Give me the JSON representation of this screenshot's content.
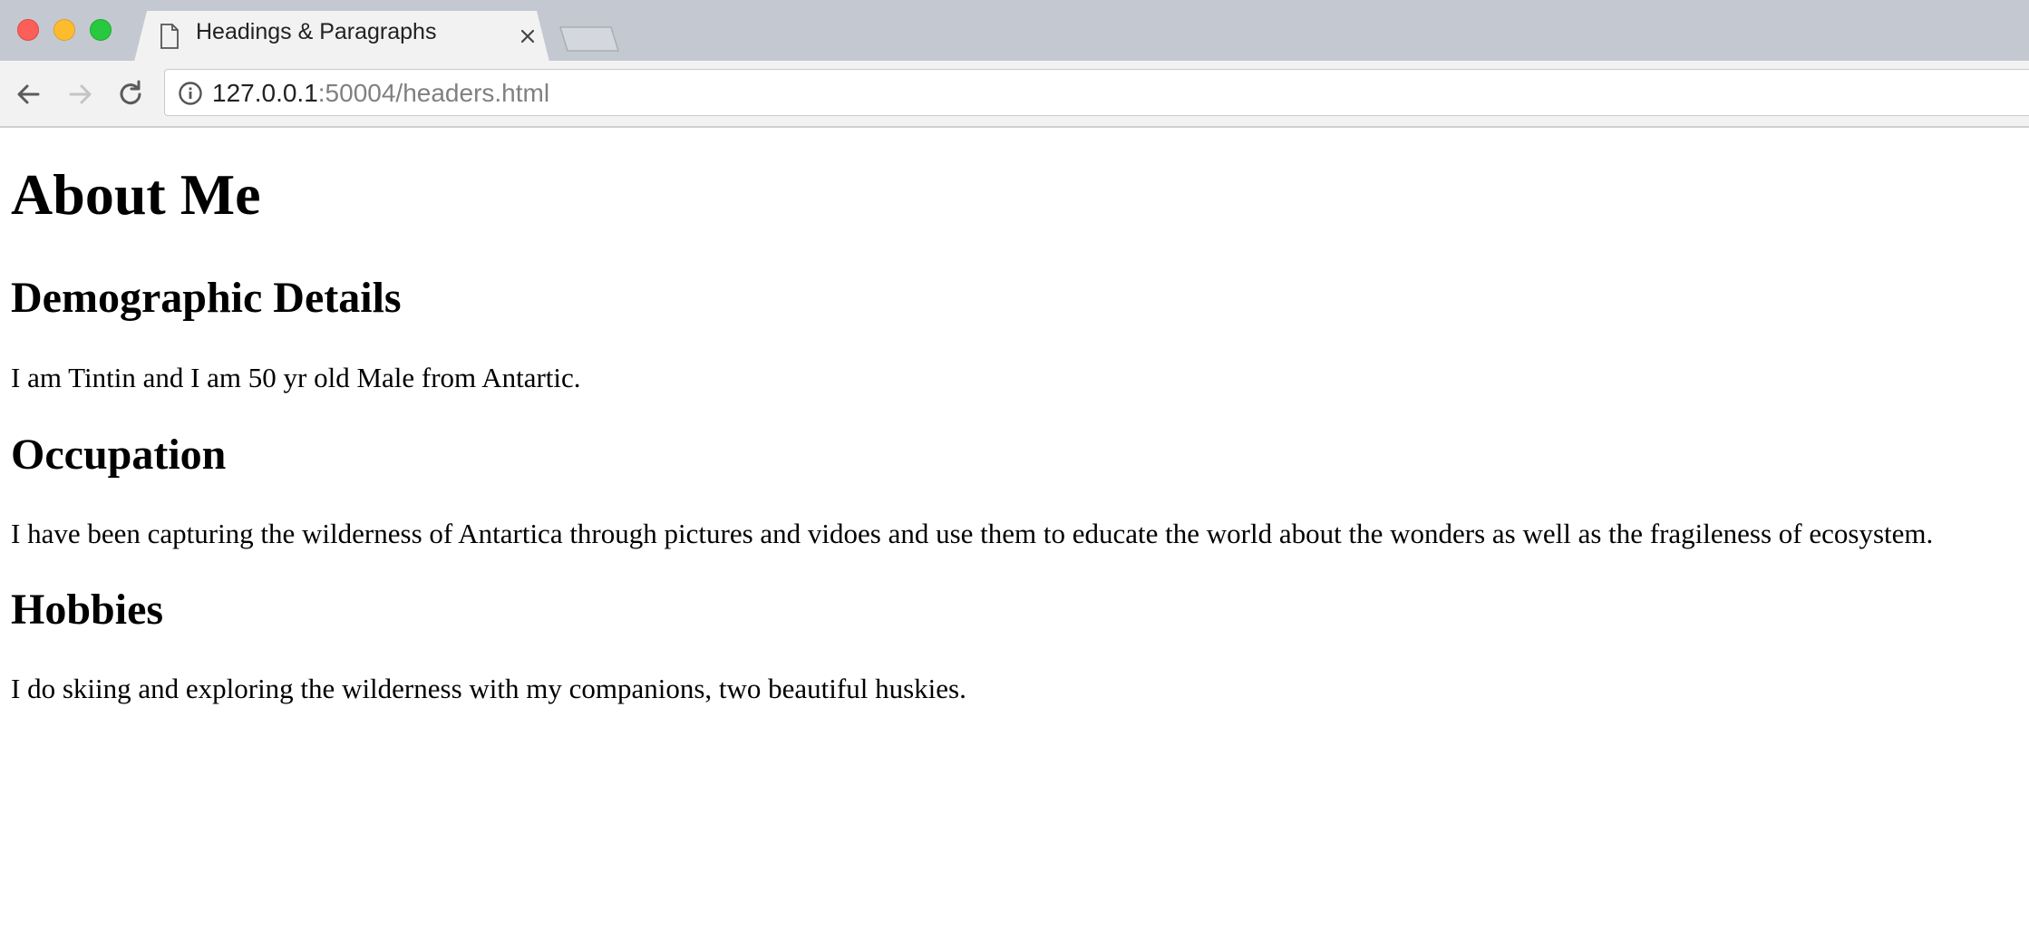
{
  "browser": {
    "tab": {
      "title": "Headings & Paragraphs"
    },
    "address_bar": {
      "host": "127.0.0.1",
      "rest": ":50004/headers.html"
    }
  },
  "page": {
    "title": "About Me",
    "sections": [
      {
        "heading": "Demographic Details",
        "text": "I am Tintin and I am 50 yr old Male from Antartic."
      },
      {
        "heading": "Occupation",
        "text": "I have been capturing the wilderness of Antartica through pictures and vidoes and use them to educate the world about the wonders as well as the fragileness of ecosystem."
      },
      {
        "heading": "Hobbies",
        "text": "I do skiing and exploring the wilderness with my companions, two beautiful huskies."
      }
    ]
  }
}
